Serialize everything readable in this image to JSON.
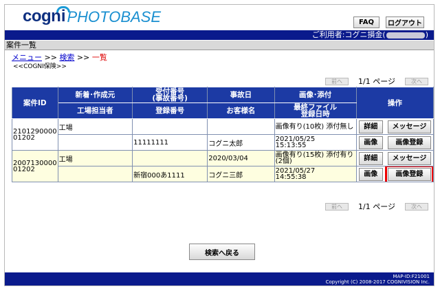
{
  "header": {
    "logo_cog": "cog",
    "logo_ni": "ni",
    "logo_photobase": "PHOTOBASE",
    "faq_label": "FAQ",
    "logout_label": "ログアウト",
    "user_prefix": "ご利用者:コグニ損金(",
    "user_suffix": ")"
  },
  "page_title": "案件一覧",
  "breadcrumb": {
    "menu": "メニュー",
    "sep1": " >> ",
    "search": "検索",
    "sep2": " >> ",
    "current": "一覧"
  },
  "subtitle": "<<COGNI保険>>",
  "pager": {
    "prev": "前へ",
    "info": "1/1 ページ",
    "next": "次へ"
  },
  "table": {
    "headers": {
      "case_id": "案件ID",
      "new_source": "新着･作成元",
      "receipt_no": "受付番号\n(事故番号)",
      "accident_date": "事故日",
      "image_attach": "画像･添付",
      "operation": "操作",
      "factory_staff": "工場担当者",
      "reg_no": "登録番号",
      "customer": "お客様名",
      "last_file": "最終ファイル\n登録日時"
    },
    "rows": [
      {
        "case_id_1": "2101290000",
        "case_id_2": "01202",
        "source": "工場",
        "receipt": "",
        "accident_date": "",
        "image_status": "画像有り(10枚) 添付無し",
        "staff": "",
        "reg_no": "11111111",
        "customer": "コグニ太郎",
        "last_date": "2021/05/25",
        "last_time": "15:13:55",
        "btn_detail": "詳細",
        "btn_message": "メッセージ",
        "btn_image": "画像",
        "btn_image_reg": "画像登録"
      },
      {
        "case_id_1": "2007130000",
        "case_id_2": "01202",
        "source": "工場",
        "receipt": "",
        "accident_date": "2020/03/04",
        "image_status": "画像有り(15枚) 添付有り(2個)",
        "staff": "",
        "reg_no": "新宿000あ1111",
        "customer": "コグニ三郎",
        "last_date": "2021/05/27",
        "last_time": "14:55:38",
        "btn_detail": "詳細",
        "btn_message": "メッセージ",
        "btn_image": "画像",
        "btn_image_reg": "画像登録"
      }
    ]
  },
  "back_button": "検索へ戻る",
  "footer": {
    "map_id": "MAP-ID:F21001",
    "copyright": "Copyright (C) 2008-2017 COGNIVISION Inc."
  },
  "colors": {
    "navy": "#0a1a8c",
    "header_blue": "#1c3aa4",
    "highlight": "#e00000"
  }
}
